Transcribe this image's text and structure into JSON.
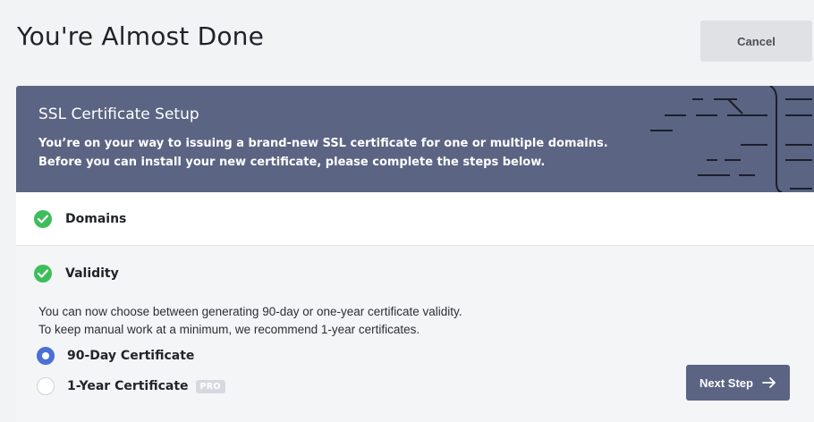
{
  "page": {
    "title": "You're Almost Done",
    "cancel_label": "Cancel"
  },
  "card": {
    "title": "SSL Certificate Setup",
    "description_line1": "You’re on your way to issuing a brand-new SSL certificate for one or multiple domains.",
    "description_line2": "Before you can install your new certificate, please complete the steps below.",
    "header_color": "#5b6483"
  },
  "steps": [
    {
      "label": "Domains",
      "status": "complete",
      "icon": "check-circle-icon"
    },
    {
      "label": "Validity",
      "status": "complete",
      "icon": "check-circle-icon"
    }
  ],
  "validity": {
    "text_line1": "You can now choose between generating 90-day or one-year certificate validity.",
    "text_line2": "To keep manual work at a minimum, we recommend 1-year certificates.",
    "options": [
      {
        "label": "90-Day Certificate",
        "selected": true
      },
      {
        "label": "1-Year Certificate",
        "selected": false,
        "badge": "PRO"
      }
    ]
  },
  "actions": {
    "next_label": "Next Step",
    "next_icon": "arrow-right-icon"
  },
  "colors": {
    "accent": "#4a6fd6",
    "success": "#3dbe5a",
    "primary_button": "#5b6483"
  }
}
